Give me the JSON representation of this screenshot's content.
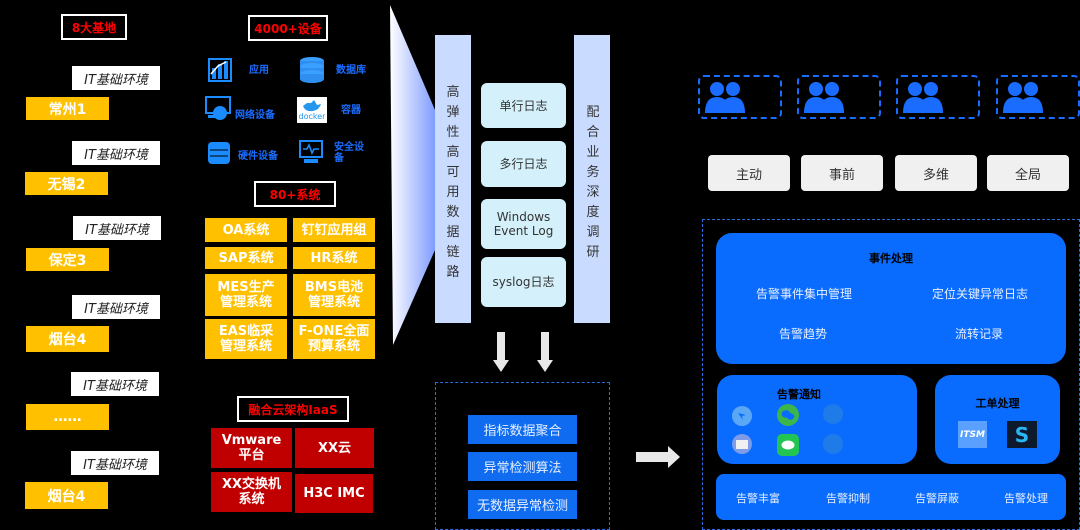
{
  "bases": {
    "header": "8大基地",
    "it_label": "IT基础环境",
    "sites": [
      "常州1",
      "无锡2",
      "保定3",
      "烟台4",
      "……",
      "烟台4"
    ]
  },
  "devices": {
    "header": "4000+设备",
    "items": [
      {
        "icon": "chart-app-icon",
        "label": "应用"
      },
      {
        "icon": "database-icon",
        "label": "数据库"
      },
      {
        "icon": "network-device-icon",
        "label": "网络设备"
      },
      {
        "icon": "docker-icon",
        "label": "容器",
        "icon_text": "docker"
      },
      {
        "icon": "server-hardware-icon",
        "label": "硬件设备"
      },
      {
        "icon": "security-device-icon",
        "label": "安全设备"
      }
    ]
  },
  "systems": {
    "header": "80+系统",
    "items": [
      "OA系统",
      "钉钉应用组",
      "SAP系统",
      "HR系统",
      "MES生产\n管理系统",
      "BMS电池\n管理系统",
      "EAS临采\n管理系统",
      "F-ONE全面\n预算系统"
    ]
  },
  "iaas": {
    "header": "融合云架构IaaS",
    "items": [
      "Vmware\n平台",
      "XX云",
      "XX交换机\n系统",
      "H3C IMC"
    ]
  },
  "pipeline": {
    "left_vertical": "高弹性高可用数据链路",
    "right_vertical": "配合业务深度调研",
    "logs": [
      "单行日志",
      "多行日志",
      "Windows\nEvent Log",
      "syslog日志"
    ]
  },
  "algorithms": [
    "指标数据聚合",
    "异常检测算法",
    "无数据异常检测"
  ],
  "teams": {
    "count": 4,
    "icon": "users-icon"
  },
  "principles": [
    "主动",
    "事前",
    "多维",
    "全局"
  ],
  "event_panel": {
    "title": "事件处理",
    "items": [
      "告警事件集中管理",
      "定位关键异常日志",
      "告警趋势",
      "流转记录"
    ]
  },
  "notify_panel": {
    "title": "告警通知",
    "icons": [
      "dingtalk-icon",
      "wechat-icon",
      "channel-icon",
      "email-icon",
      "sms-icon",
      "channel-icon"
    ]
  },
  "ticket_panel": {
    "title": "工单处理",
    "icons": [
      {
        "name": "itsm-icon",
        "text": "ITSM"
      },
      {
        "name": "s-logo-icon",
        "text": "S"
      }
    ]
  },
  "alert_bar": {
    "items": [
      "告警丰富",
      "告警抑制",
      "告警屏蔽",
      "告警处理"
    ]
  },
  "colors": {
    "gold": "#ffc000",
    "red": "#c00000",
    "blue": "#0a6cff",
    "light_blue": "#c9dcff"
  }
}
